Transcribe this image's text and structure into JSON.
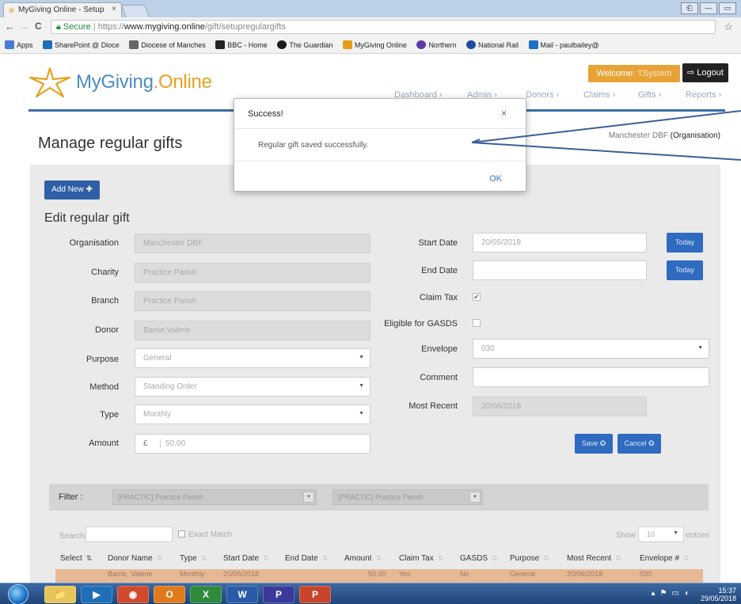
{
  "browser": {
    "tab_title": "MyGiving Online - Setup",
    "tab_close": "×",
    "nav_back": "←",
    "nav_forward": "→",
    "nav_reload": "C",
    "url_secure": "Secure",
    "url_sep": "|",
    "url_scheme": "https://",
    "url_host": "www.mygiving.online",
    "url_path": "/gift/setupregulargifts",
    "bookmark_star": "☆",
    "window_buttons": [
      "⎗",
      "—",
      "▭"
    ],
    "bookmarks": [
      {
        "label": "Apps",
        "color": "#4a7bd6"
      },
      {
        "label": "SharePoint @ Dioce",
        "color": "#1e6fb8"
      },
      {
        "label": "Diocese of Manches",
        "color": "#666666"
      },
      {
        "label": "BBC - Home",
        "color": "#222222"
      },
      {
        "label": "The Guardian",
        "color": "#1b1b1b"
      },
      {
        "label": "MyGiving Online",
        "color": "#e69b18"
      },
      {
        "label": "Northern",
        "color": "#5a3aa8"
      },
      {
        "label": "National Rail",
        "color": "#1d4c9c"
      },
      {
        "label": "Mail - paulbailey@",
        "color": "#1f6fc4"
      }
    ]
  },
  "header": {
    "logo_my": "My",
    "logo_giving": "Giving",
    "logo_dot_online": ".Online",
    "welcome_label": "Welcome:",
    "welcome_user": "TSystem",
    "logout_label": "⇨ Logout",
    "menu": [
      "Dashboard ›",
      "Admin ›",
      "Donors ›",
      "Claims ›",
      "Gifts ›",
      "Reports ›"
    ]
  },
  "page": {
    "title": "Manage regular gifts",
    "org_name": "Manchester DBF",
    "org_type": "(Organisation)",
    "add_new": "Add New ✚",
    "section_title": "Edit regular gift"
  },
  "form": {
    "organisation": {
      "label": "Organisation",
      "value": "Manchester DBF"
    },
    "charity": {
      "label": "Charity",
      "value": "Practice Parish"
    },
    "branch": {
      "label": "Branch",
      "value": "Practice Parish"
    },
    "donor": {
      "label": "Donor",
      "value": "Barrie,Valerie"
    },
    "purpose": {
      "label": "Purpose",
      "value": "General"
    },
    "method": {
      "label": "Method",
      "value": "Standing Order"
    },
    "type": {
      "label": "Type",
      "value": "Monthly"
    },
    "amount": {
      "label": "Amount",
      "currency": "£",
      "value": "50.00"
    },
    "start_date": {
      "label": "Start Date",
      "value": "20/05/2018",
      "today": "Today"
    },
    "end_date": {
      "label": "End Date",
      "value": "",
      "today": "Today"
    },
    "claim_tax": {
      "label": "Claim Tax",
      "checked": true
    },
    "gasds": {
      "label": "Eligible for GASDS",
      "checked": false
    },
    "envelope": {
      "label": "Envelope",
      "value": "030"
    },
    "comment": {
      "label": "Comment",
      "value": ""
    },
    "most_recent": {
      "label": "Most Recent",
      "value": "20/06/2018"
    },
    "save": "Save ✪",
    "cancel": "Cancel ✪"
  },
  "filter": {
    "label": "Filter :",
    "charity": "[PRACTIC] Practice Parish",
    "branch": "[PRACTIC] Practice Parish"
  },
  "table_controls": {
    "search_label": "Search:",
    "exact_match": "Exact Match",
    "show": "Show",
    "show_value": "10",
    "entries": "entries"
  },
  "table": {
    "columns": [
      "Select",
      "Donor Name",
      "Type",
      "Start Date",
      "End Date",
      "Amount",
      "Claim Tax",
      "GASDS",
      "Purpose",
      "Most Recent",
      "Envelope #"
    ],
    "partial_row": [
      "Barrie, Valerie",
      "Monthly",
      "20/05/2018",
      "50.00",
      "Yes",
      "No",
      "General",
      "20/06/2018",
      "030"
    ]
  },
  "modal": {
    "title": "Success!",
    "close": "×",
    "message": "Regular gift saved successfully.",
    "ok": "OK"
  },
  "taskbar": {
    "time": "15:37",
    "date": "29/05/2018",
    "apps": [
      "📁",
      "▶",
      "◉",
      "O",
      "X",
      "W",
      "P",
      "P"
    ]
  },
  "colors": {
    "brand_blue": "#2f5fa6",
    "brand_orange": "#e8a336",
    "annotation_arrow": "#3b5f96"
  }
}
